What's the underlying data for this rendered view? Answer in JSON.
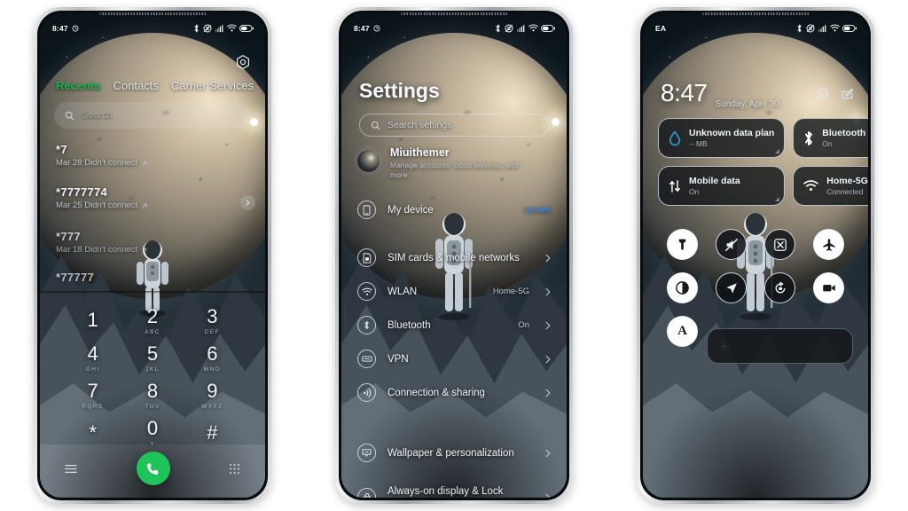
{
  "page": {
    "background_color": "#ffffff",
    "device_count": 3
  },
  "phone1": {
    "name": "dialer-phone",
    "statusbar": {
      "time": "8:47",
      "alarm_icon": "alarm-icon",
      "icons": [
        "bluetooth-icon",
        "dnd-mute-icon",
        "signal-icon",
        "wifi-icon",
        "battery-icon"
      ]
    },
    "camera_button_icon": "camera-icon",
    "tabs": [
      {
        "label": "Recents",
        "active": true
      },
      {
        "label": "Contacts",
        "active": false
      },
      {
        "label": "Carrier Services",
        "active": false
      }
    ],
    "active_tab_color": "#19b24a",
    "search": {
      "placeholder": "Search",
      "icon": "search-icon"
    },
    "call_log": [
      {
        "number": "*7",
        "detail": "Mar 28 Didn't connect"
      },
      {
        "number": "*7777774",
        "detail": "Mar 25 Didn't connect"
      },
      {
        "number": "*777",
        "detail": "Mar 18 Didn't connect"
      },
      {
        "number": "*77777",
        "detail": ""
      }
    ],
    "next_arrow_icon": "chevron-right-icon",
    "dialpad": [
      {
        "digit": "1",
        "letters": ""
      },
      {
        "digit": "2",
        "letters": "ABC"
      },
      {
        "digit": "3",
        "letters": "DEF"
      },
      {
        "digit": "4",
        "letters": "GHI"
      },
      {
        "digit": "5",
        "letters": "JKL"
      },
      {
        "digit": "6",
        "letters": "MNO"
      },
      {
        "digit": "7",
        "letters": "PQRS"
      },
      {
        "digit": "8",
        "letters": "TUV"
      },
      {
        "digit": "9",
        "letters": "WXYZ"
      },
      {
        "digit": "*",
        "letters": ""
      },
      {
        "digit": "0",
        "letters": "+"
      },
      {
        "digit": "#",
        "letters": ""
      }
    ],
    "bottom": {
      "menu_icon": "menu-icon",
      "call_icon": "call-icon",
      "keypad_icon": "keypad-icon",
      "call_button_color": "#1fc35a"
    }
  },
  "phone2": {
    "name": "settings-phone",
    "statusbar": {
      "time": "8:47",
      "alarm_icon": "alarm-icon",
      "icons": [
        "bluetooth-icon",
        "dnd-mute-icon",
        "signal-icon",
        "wifi-icon",
        "battery-icon"
      ]
    },
    "title": "Settings",
    "search": {
      "placeholder": "Search settings",
      "icon": "search-icon"
    },
    "account": {
      "name": "Miuithemer",
      "subtitle": "Manage accounts, cloud services, and more",
      "avatar": "avatar"
    },
    "rows": [
      {
        "icon": "phone-device-icon",
        "label": "My device",
        "value": "",
        "badge": "Update",
        "chevron": false
      },
      {
        "icon": "sim-card-icon",
        "label": "SIM cards & mobile networks",
        "value": "",
        "badge": "",
        "chevron": true
      },
      {
        "icon": "wifi-icon",
        "label": "WLAN",
        "value": "Home-5G",
        "badge": "",
        "chevron": true
      },
      {
        "icon": "bluetooth-icon",
        "label": "Bluetooth",
        "value": "On",
        "badge": "",
        "chevron": true
      },
      {
        "icon": "vpn-icon",
        "label": "VPN",
        "value": "",
        "badge": "",
        "chevron": true
      },
      {
        "icon": "connection-share-icon",
        "label": "Connection & sharing",
        "value": "",
        "badge": "",
        "chevron": true
      },
      {
        "icon": "wallpaper-icon",
        "label": "Wallpaper & personalization",
        "value": "",
        "badge": "",
        "chevron": true
      },
      {
        "icon": "lock-icon",
        "label": "Always-on display & Lock screen",
        "value": "",
        "badge": "",
        "chevron": true
      }
    ],
    "update_badge_color": "#2f8bff"
  },
  "phone3": {
    "name": "control-center-phone",
    "statusbar": {
      "carrier": "EA",
      "icons": [
        "bluetooth-icon",
        "dnd-mute-icon",
        "signal-icon",
        "wifi-icon",
        "battery-icon"
      ]
    },
    "clock": {
      "time": "8:47",
      "date": "Sunday, April 30"
    },
    "actions": [
      {
        "icon": "settings-gear-icon",
        "name": "settings-shortcut"
      },
      {
        "icon": "edit-icon",
        "name": "edit-shortcut"
      }
    ],
    "tiles": [
      {
        "icon": "data-drop-icon",
        "title": "Unknown data plan",
        "sub": "-- MB",
        "icon_color": "#2b9fe8",
        "active": false
      },
      {
        "icon": "bluetooth-icon",
        "title": "Bluetooth",
        "sub": "On",
        "icon_color": "#ffffff",
        "active": true
      },
      {
        "icon": "mobile-data-icon",
        "title": "Mobile data",
        "sub": "On",
        "icon_color": "#ffffff",
        "active": true
      },
      {
        "icon": "wifi-icon",
        "title": "Home-5G",
        "sub": "Connected",
        "icon_color": "#ffffff",
        "active": true
      }
    ],
    "quick_settings": [
      {
        "icon": "flashlight-icon",
        "on": true
      },
      {
        "icon": "silent-mode-icon",
        "on": false
      },
      {
        "icon": "screenshot-icon",
        "on": false
      },
      {
        "icon": "airplane-icon",
        "on": true
      },
      {
        "icon": "dark-mode-icon",
        "on": true
      },
      {
        "icon": "location-icon",
        "on": false
      },
      {
        "icon": "rotation-lock-icon",
        "on": false
      },
      {
        "icon": "screen-record-icon",
        "on": true
      },
      {
        "icon": "auto-brightness-icon",
        "label": "A",
        "on": true
      }
    ],
    "brightness_slider": {
      "icon": "brightness-sun-icon",
      "value": 8
    }
  }
}
